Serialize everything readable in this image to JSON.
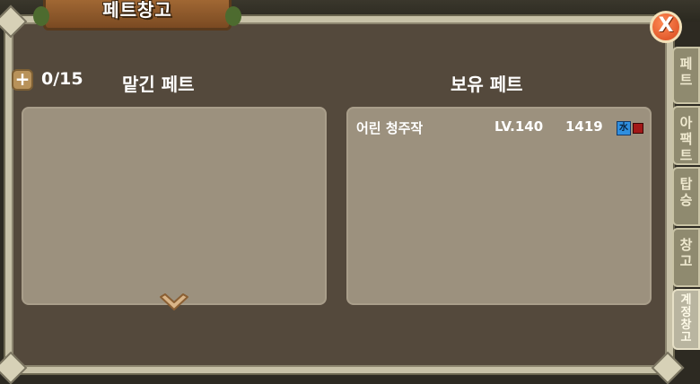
{
  "window": {
    "title": "페트창고",
    "close_label": "X"
  },
  "stash": {
    "count": "0/15",
    "heading": "맡긴 페트"
  },
  "owned": {
    "heading": "보유 페트",
    "pets": [
      {
        "name": "어린 청주작",
        "level": "LV.140",
        "power": "1419",
        "element_water": "水"
      }
    ]
  },
  "side_tabs": [
    {
      "label": "페\n트"
    },
    {
      "label": "아\n팩\n트"
    },
    {
      "label": "탑\n승"
    },
    {
      "label": "창\n고"
    },
    {
      "label": "계\n정\n창\n고"
    }
  ],
  "colors": {
    "panel": "#9c917e",
    "frame_bg": "#54493c",
    "close_button": "#d6471c"
  }
}
